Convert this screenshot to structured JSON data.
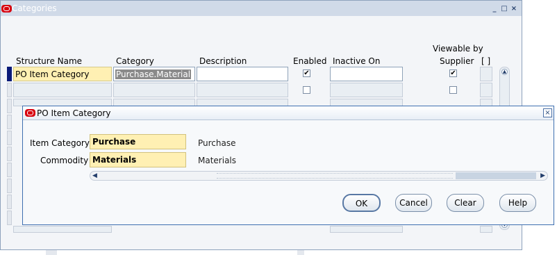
{
  "main_window": {
    "title": "Categories",
    "window_buttons": [
      "_",
      "□",
      "×"
    ],
    "columns": {
      "structure_name": "Structure Name",
      "category": "Category",
      "description": "Description",
      "enabled": "Enabled",
      "inactive_on": "Inactive On",
      "viewable_line1": "Viewable by",
      "viewable_line2": "Supplier",
      "flex": "[ ]"
    },
    "rows": [
      {
        "structure_name": "PO Item Category",
        "category": "Purchase.Material",
        "enabled": "✔",
        "viewable": "✔"
      },
      {
        "structure_name": "",
        "category": "",
        "enabled": "",
        "viewable": ""
      }
    ]
  },
  "dialog": {
    "title": "PO Item Category",
    "close_icon": "×",
    "fields": [
      {
        "label": "Item Category",
        "value": "Purchase",
        "description": "Purchase"
      },
      {
        "label": "Commodity",
        "value": "Materials",
        "description": "Materials"
      }
    ],
    "buttons": {
      "ok": "OK",
      "cancel": "Cancel",
      "clear": "Clear",
      "help": "Help"
    }
  },
  "icons": {
    "oracle": "oracle-icon",
    "checked_glyph": "✔"
  },
  "colors": {
    "accent_field": "#fff0b3",
    "titlebar": "#d0dae8",
    "dialog_border": "#3e6fb0"
  }
}
